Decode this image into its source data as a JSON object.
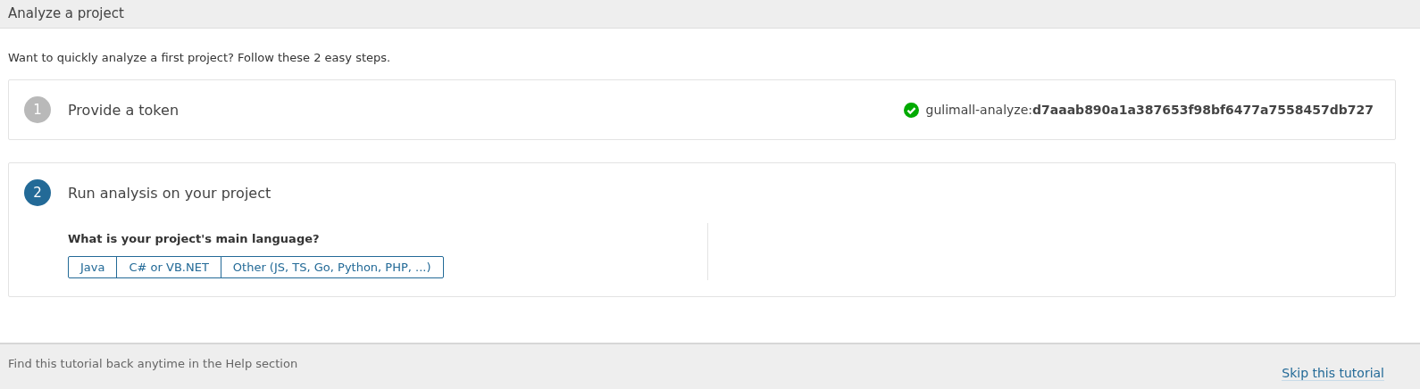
{
  "header": {
    "title": "Analyze a project"
  },
  "intro": "Want to quickly analyze a first project? Follow these 2 easy steps.",
  "steps": [
    {
      "number": "1",
      "title": "Provide a token",
      "active": false,
      "token": "gulimall-analyze:**d7aaab890a1a387653f98bf6477a7558457db727**"
    },
    {
      "number": "2",
      "title": "Run analysis on your project",
      "active": true,
      "question": "What is your project's main language?",
      "options": [
        {
          "label": "Java",
          "selected": false
        },
        {
          "label": "C# or VB.NET",
          "selected": false
        },
        {
          "label": "Other (JS, TS, Go, Python, PHP, ...)",
          "selected": false
        }
      ]
    }
  ],
  "footer": {
    "note": "Find this tutorial back anytime in the Help section",
    "link": "Skip this tutorial"
  }
}
